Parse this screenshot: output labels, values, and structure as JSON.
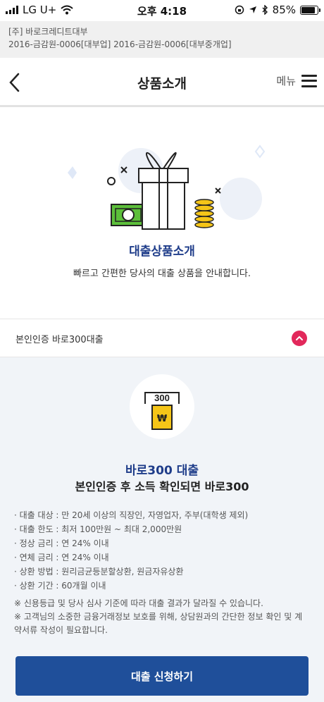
{
  "status_bar": {
    "carrier": "LG U+",
    "time": "오후 4:18",
    "battery": "85%",
    "battery_level": 0.85
  },
  "company": {
    "name": "[주] 바로크레디트대부",
    "registration": "2016-금감원-0006[대부업] 2016-금감원-0006[대부중개업]"
  },
  "header": {
    "title": "상품소개",
    "menu_label": "메뉴",
    "back_icon": "chevron-left-icon",
    "menu_icon": "hamburger-icon"
  },
  "hero": {
    "title": "대출상품소개",
    "description": "빠르고 간편한 당사의 대출 상품을 안내합니다.",
    "illustration_icons": [
      "gift-box-icon",
      "banknote-icon",
      "coin-stack-icon"
    ]
  },
  "accordion": {
    "title": "본인인증 바로300대출",
    "toggle_icon": "chevron-up-icon",
    "toggle_color": "#e2285b"
  },
  "product": {
    "icon_label": "300",
    "icon_symbol": "₩",
    "name": "바로300 대출",
    "subtitle": "본인인증 후 소득 확인되면 바로300",
    "details": [
      "· 대출 대상 : 만 20세 이상의 직장인, 자영업자, 주부(대학생 제외)",
      "· 대출 한도 : 최저 100만원 ~ 최대 2,000만원",
      "· 정상 금리 : 연 24% 이내",
      "· 연체 금리 : 연 24% 이내",
      "· 상환 방법 : 원리금균등분할상환, 원금자유상환",
      "· 상환 기간 : 60개월 이내"
    ],
    "notes": [
      "※ 신용등급 및 당사 심사 기준에 따라 대출 결과가 달라질 수 있습니다.",
      "※ 고객님의 소중한 금융거래정보 보호를 위해, 상담원과의 간단한 정보 확인 및 계약서류 작성이 필요합니다."
    ],
    "apply_label": "대출 신청하기"
  },
  "colors": {
    "brand_blue": "#1f3d8a",
    "button_blue": "#1f4f9a",
    "accent_pink": "#e2285b",
    "money_green": "#5cbf3a",
    "coin_yellow": "#f5c518"
  }
}
